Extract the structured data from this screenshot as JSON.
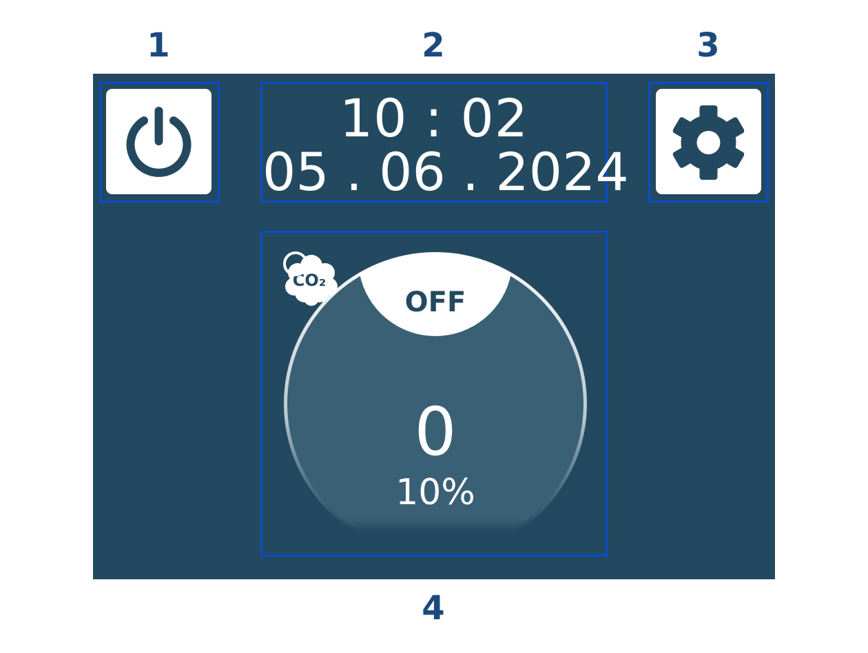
{
  "callouts": {
    "power": "1",
    "datetime": "2",
    "settings": "3",
    "dial": "4"
  },
  "header": {
    "time": "10 : 02",
    "date": "05 . 06 . 2024"
  },
  "dial": {
    "state": "OFF",
    "sensor_label": "CO₂",
    "value": "0",
    "percent": "10%"
  },
  "icons": {
    "power": "power-icon",
    "settings": "gear-icon",
    "sensor": "co2-cloud-icon",
    "indicator": "ring-indicator-icon"
  },
  "colors": {
    "screen_background": "#234960",
    "dial_fill": "#3a6075",
    "highlight_outline": "#0a4ccc",
    "callout_text": "#1c4a7e",
    "icon_card": "#ffffff"
  }
}
